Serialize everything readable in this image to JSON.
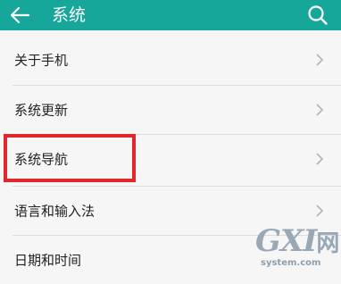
{
  "header": {
    "title": "系统",
    "back_icon": "arrow-left-icon",
    "search_icon": "search-icon"
  },
  "settings": {
    "items": [
      {
        "label": "关于手机"
      },
      {
        "label": "系统更新"
      },
      {
        "label": "系统导航"
      },
      {
        "label": "语言和输入法"
      },
      {
        "label": "日期和时间"
      }
    ]
  },
  "annotation": {
    "highlighted_item": "系统导航",
    "color": "#e2262b"
  },
  "watermark": {
    "logo": "GXI",
    "logo_cn": "网",
    "site": "system.com"
  },
  "colors": {
    "header_bg": "#16a79a",
    "list_bg": "#f6f6f6",
    "text": "#222222"
  }
}
